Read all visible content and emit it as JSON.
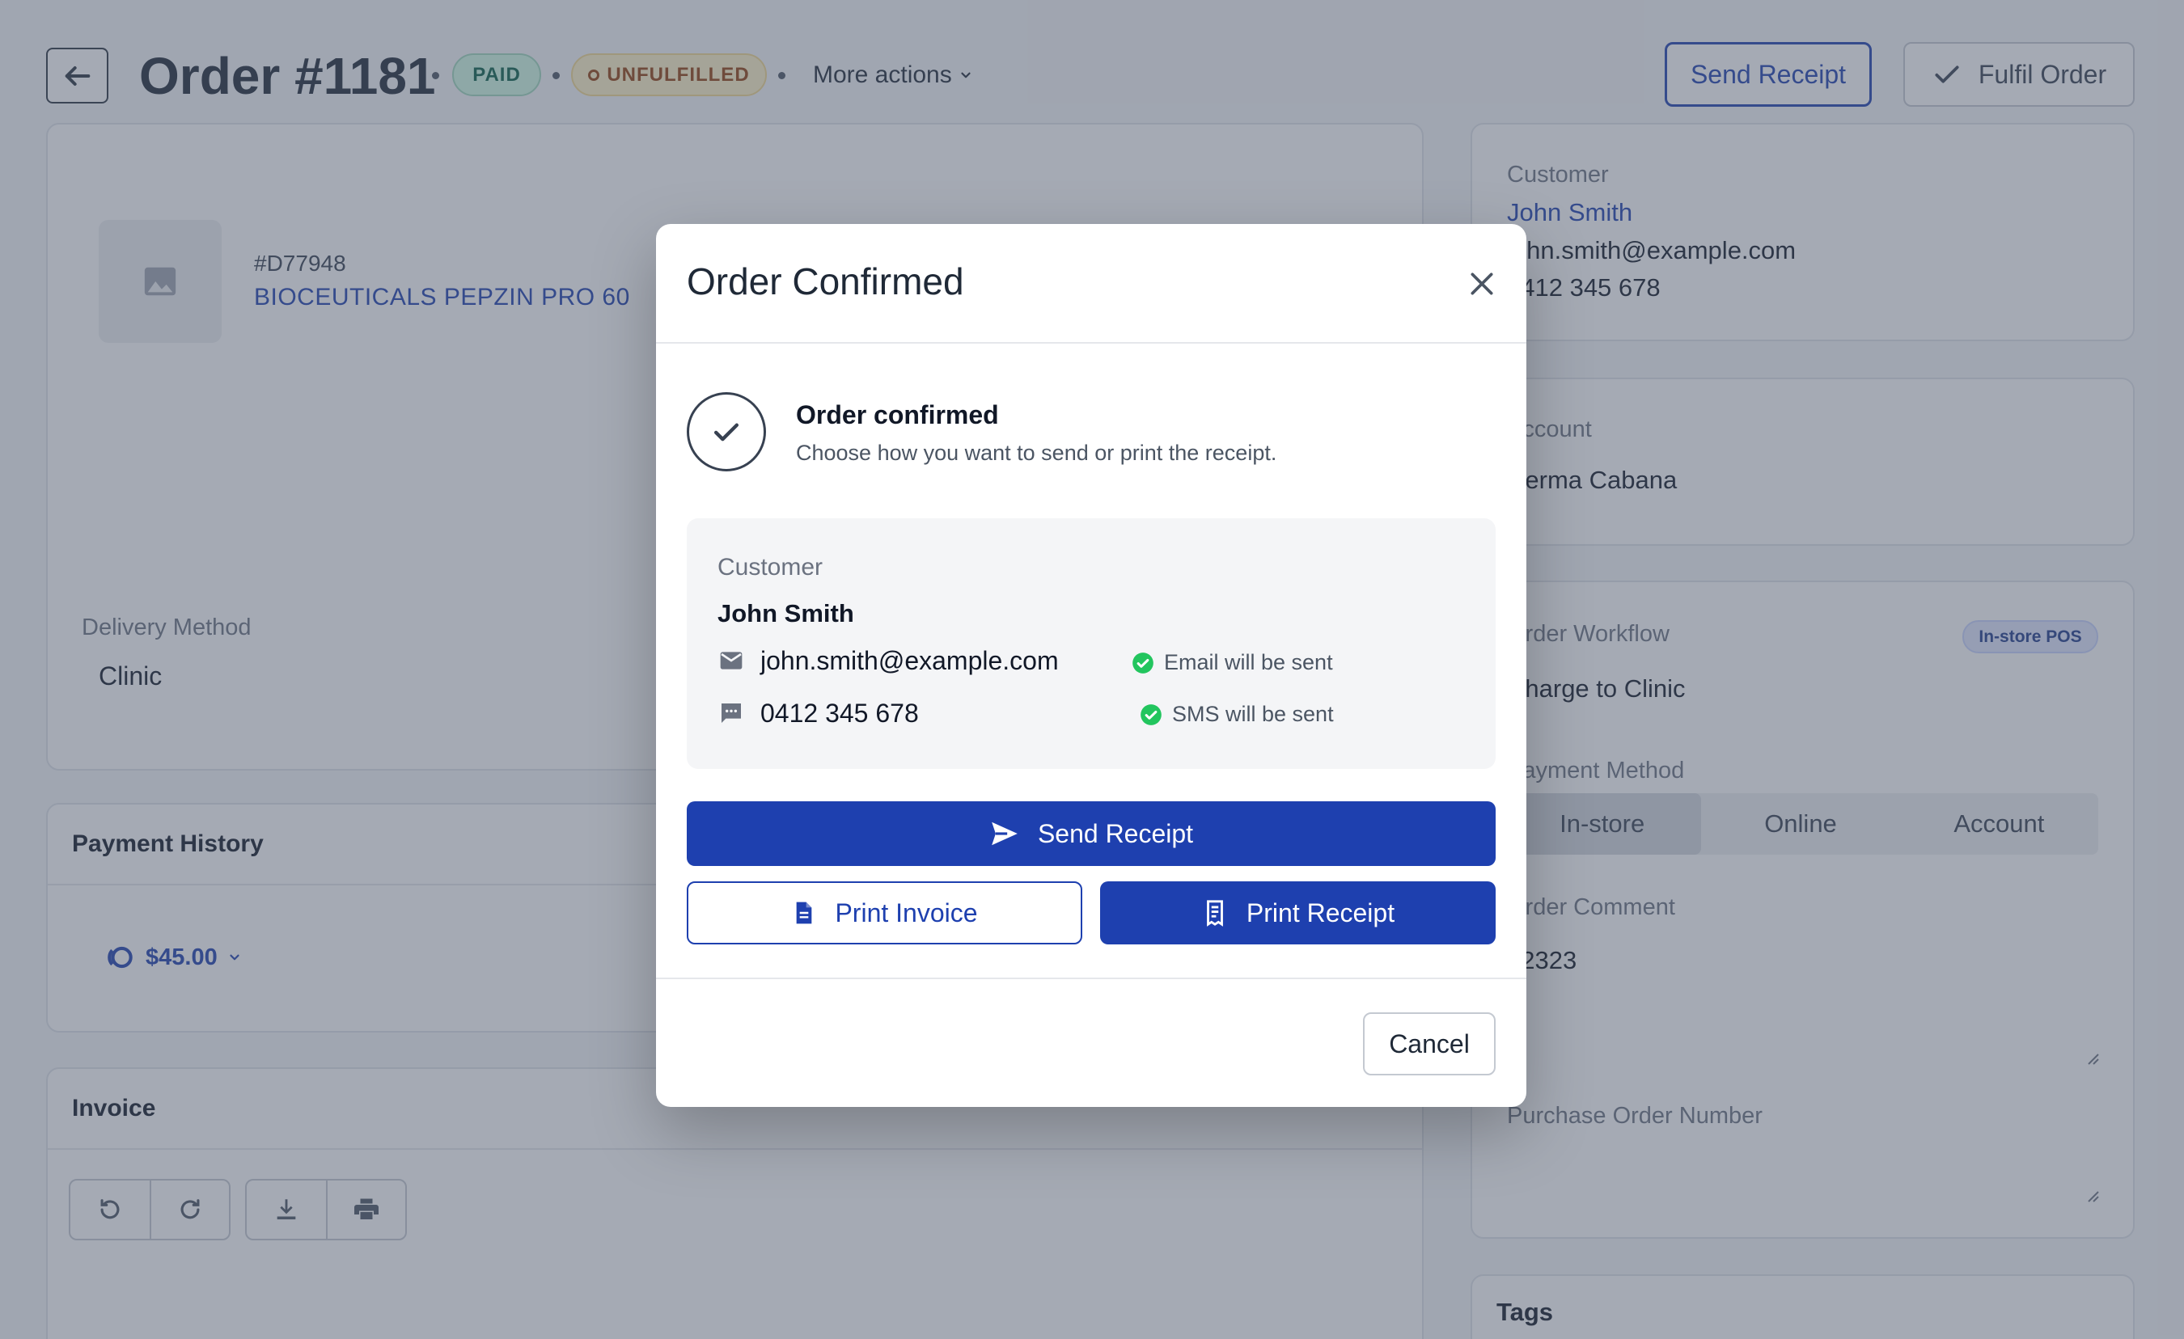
{
  "header": {
    "title": "Order #1181",
    "paid_badge": "PAID",
    "unfulfilled_badge": "UNFULFILLED",
    "more_actions": "More actions",
    "send_receipt": "Send Receipt",
    "fulfil_order": "Fulfil Order"
  },
  "line_item": {
    "sku": "#D77948",
    "product": "BIOCEUTICALS PEPZIN PRO 60"
  },
  "delivery": {
    "label": "Delivery Method",
    "value": "Clinic"
  },
  "payment_history": {
    "title": "Payment History",
    "amount": "$45.00"
  },
  "invoice": {
    "title": "Invoice"
  },
  "customer_card": {
    "label": "Customer",
    "name": "John Smith",
    "email": "john.smith@example.com",
    "phone": "0412 345 678"
  },
  "account_card": {
    "label": "Account",
    "value": "Derma Cabana"
  },
  "workflow_card": {
    "label": "Order Workflow",
    "badge": "In-store POS",
    "value": "Charge to Clinic",
    "payment_label": "Payment Method",
    "payment_options": [
      "In-store",
      "Online",
      "Account"
    ],
    "payment_selected": "In-store",
    "comment_label": "Order Comment",
    "comment_value": "12323",
    "po_label": "Purchase Order Number",
    "po_value": ""
  },
  "tags_card": {
    "title": "Tags"
  },
  "modal": {
    "title": "Order Confirmed",
    "heading": "Order confirmed",
    "subtext": "Choose how you want to send or print the receipt.",
    "customer_label": "Customer",
    "customer_name": "John Smith",
    "email": "john.smith@example.com",
    "email_status": "Email will be sent",
    "phone": "0412 345 678",
    "sms_status": "SMS will be sent",
    "send_receipt": "Send Receipt",
    "print_invoice": "Print Invoice",
    "print_receipt": "Print Receipt",
    "cancel": "Cancel"
  },
  "colors": {
    "primary": "#1e40af",
    "success": "#22c55e",
    "paid_bg": "#d1fae5",
    "unfulfilled_bg": "#fef3c7",
    "overlay": "#4b5569"
  }
}
